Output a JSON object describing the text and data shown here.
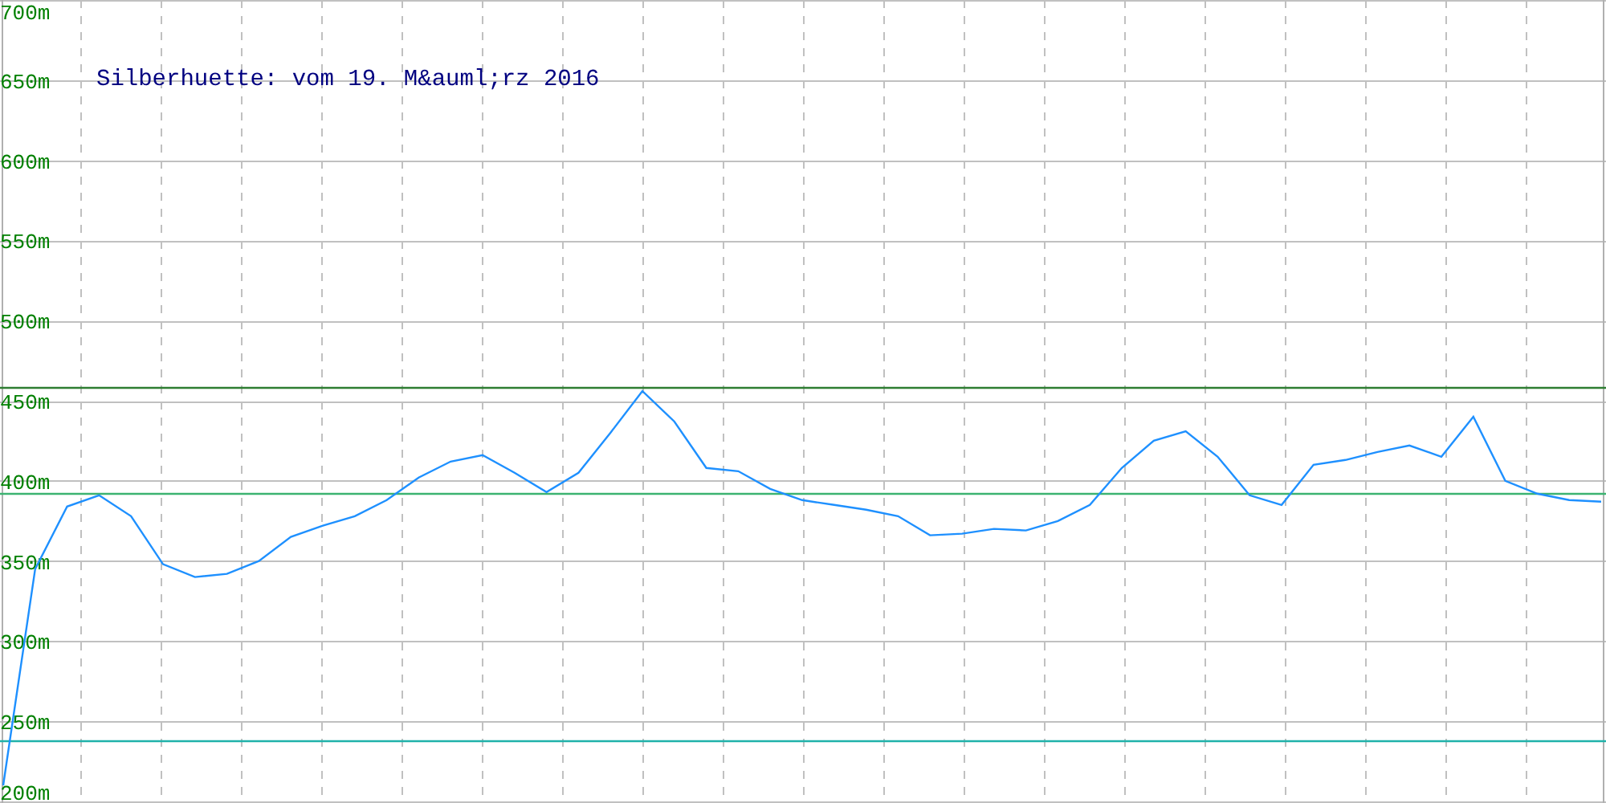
{
  "chart": {
    "title": "Silberhuette: vom 19. M&auml;rz 2016",
    "chart_data": {
      "type": "line",
      "ylim": [
        200,
        700
      ],
      "yticks": [
        {
          "value": 200,
          "label": "200m"
        },
        {
          "value": 250,
          "label": "250m"
        },
        {
          "value": 300,
          "label": "300m"
        },
        {
          "value": 350,
          "label": "350m"
        },
        {
          "value": 400,
          "label": "400m"
        },
        {
          "value": 450,
          "label": "450m"
        },
        {
          "value": 500,
          "label": "500m"
        },
        {
          "value": 550,
          "label": "550m"
        },
        {
          "value": 600,
          "label": "600m"
        },
        {
          "value": 650,
          "label": "650m"
        },
        {
          "value": 700,
          "label": "700m"
        }
      ],
      "series": [
        {
          "color": "#1e90ff",
          "values": [
            210,
            345,
            384,
            391,
            378,
            348,
            340,
            342,
            350,
            365,
            372,
            378,
            388,
            402,
            412,
            416,
            405,
            393,
            405,
            430,
            456,
            437,
            408,
            406,
            395,
            388,
            385,
            382,
            378,
            366,
            367,
            370,
            369,
            375,
            385,
            408,
            425,
            431,
            415,
            391,
            385,
            410,
            413,
            418,
            422,
            415,
            440,
            400,
            392,
            388,
            387
          ]
        }
      ],
      "grid": true,
      "ref_lines": [
        {
          "axis": "y",
          "value": 459,
          "color": "#2e7d32"
        },
        {
          "axis": "y",
          "value": 392,
          "color": "#3cb371"
        },
        {
          "axis": "y",
          "value": 238,
          "color": "#20b2aa"
        }
      ]
    }
  }
}
